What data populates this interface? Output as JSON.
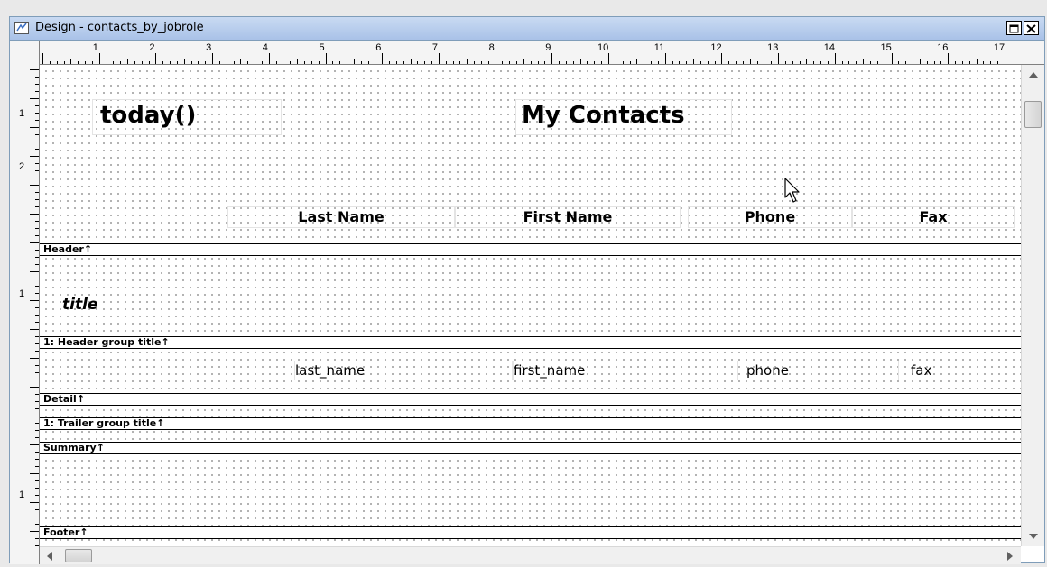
{
  "window": {
    "title": "Design - contacts_by_jobrole",
    "icon": "datawindow-painter-icon"
  },
  "ruler": {
    "horizontal": [
      "1",
      "2",
      "3",
      "4",
      "5",
      "6",
      "7",
      "8",
      "9",
      "10",
      "11",
      "12",
      "13",
      "14",
      "15",
      "16",
      "17"
    ],
    "vertical": [
      {
        "label": "1"
      },
      {
        "label": "2"
      },
      {
        "label": "1"
      },
      {
        "label": "1"
      }
    ]
  },
  "header": {
    "today": "today()",
    "title": "My Contacts",
    "columns": {
      "last_name": "Last Name",
      "first_name": "First Name",
      "phone": "Phone",
      "fax": "Fax"
    }
  },
  "bands": {
    "header": "Header↑",
    "header_group": "1: Header group title↑",
    "detail": "Detail↑",
    "trailer_group": "1: Trailer group title↑",
    "summary": "Summary↑",
    "footer": "Footer↑"
  },
  "group": {
    "title": "title"
  },
  "detail": {
    "last_name": "last_name",
    "first_name": "first_name",
    "phone": "phone",
    "fax": "fax"
  },
  "colors": {
    "titlebar": "#a9c2e8",
    "window_border": "#7f9db9",
    "grid_dot": "#9a9a9a"
  }
}
